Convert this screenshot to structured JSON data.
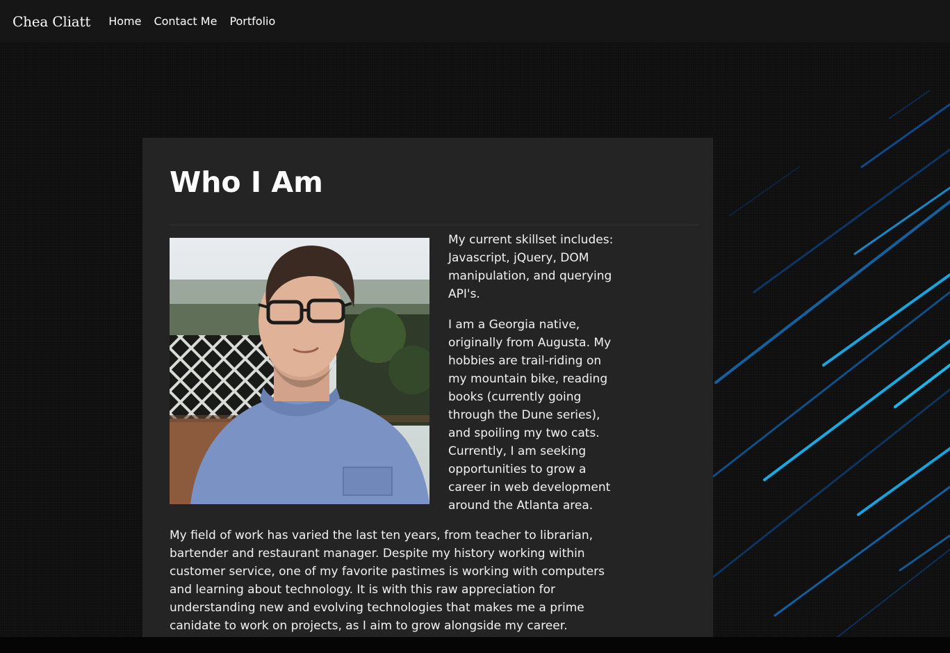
{
  "nav": {
    "brand": "Chea Cliatt",
    "links": [
      "Home",
      "Contact Me",
      "Portfolio"
    ]
  },
  "about": {
    "title": "Who I Am",
    "skills": "My current skillset includes: Javascript, jQuery, DOM manipulation, and querying API's.",
    "bio": "I am a Georgia native, originally from Augusta. My hobbies are trail-riding on my mountain bike, reading books (currently going through the Dune series), and spoiling my two cats. Currently, I am seeking opportunities to grow a career in web development around the Atlanta area.",
    "work": "My field of work has varied the last ten years, from teacher to librarian, bartender and restaurant manager. Despite my history working within customer service, one of my favorite pastimes is working with computers and learning about technology. It is with this raw appreciation for understanding new and evolving technologies that makes me a prime canidate to work on projects, as I aim to grow alongside my career."
  },
  "colors": {
    "accent": "#19b4e6",
    "card": "#242424",
    "navbar": "#161616"
  }
}
